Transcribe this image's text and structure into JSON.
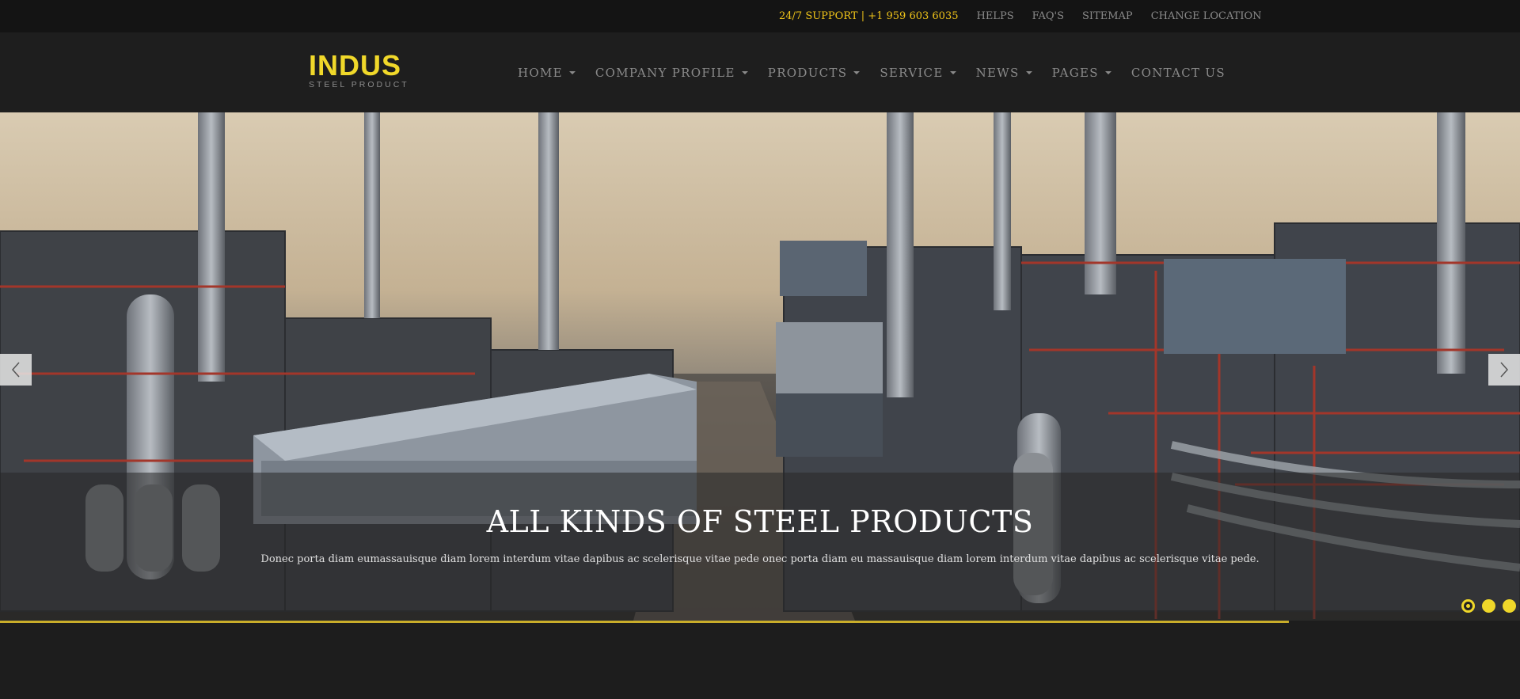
{
  "topbar": {
    "support": "24/7 SUPPORT | +1 959 603 6035",
    "links": [
      "HELPS",
      "FAQ'S",
      "SITEMAP",
      "CHANGE LOCATION"
    ]
  },
  "logo": {
    "word": "INDUS",
    "sub": "STEEL PRODUCT"
  },
  "nav": [
    {
      "label": "HOME",
      "dropdown": true
    },
    {
      "label": "COMPANY PROFILE",
      "dropdown": true
    },
    {
      "label": "PRODUCTS",
      "dropdown": true
    },
    {
      "label": "SERVICE",
      "dropdown": true
    },
    {
      "label": "NEWS",
      "dropdown": true
    },
    {
      "label": "PAGES",
      "dropdown": true
    },
    {
      "label": "CONTACT US",
      "dropdown": false
    }
  ],
  "slider": {
    "title": "ALL KINDS OF STEEL PRODUCTS",
    "text": "Donec porta diam eumassauisque diam lorem interdum vitae dapibus ac scelerisque vitae pede onec porta diam eu massauisque diam lorem interdum vitae dapibus ac scelerisque vitae pede.",
    "dots": 3,
    "active_dot": 0,
    "progress": 0.848,
    "prev_icon": "chevron-left-icon",
    "next_icon": "chevron-right-icon"
  },
  "colors": {
    "accent": "#f0d82a",
    "support_text": "#f0c419",
    "topbar_bg": "#141414",
    "header_bg": "#1e1e1e",
    "nav_text": "#8a8a8a"
  }
}
